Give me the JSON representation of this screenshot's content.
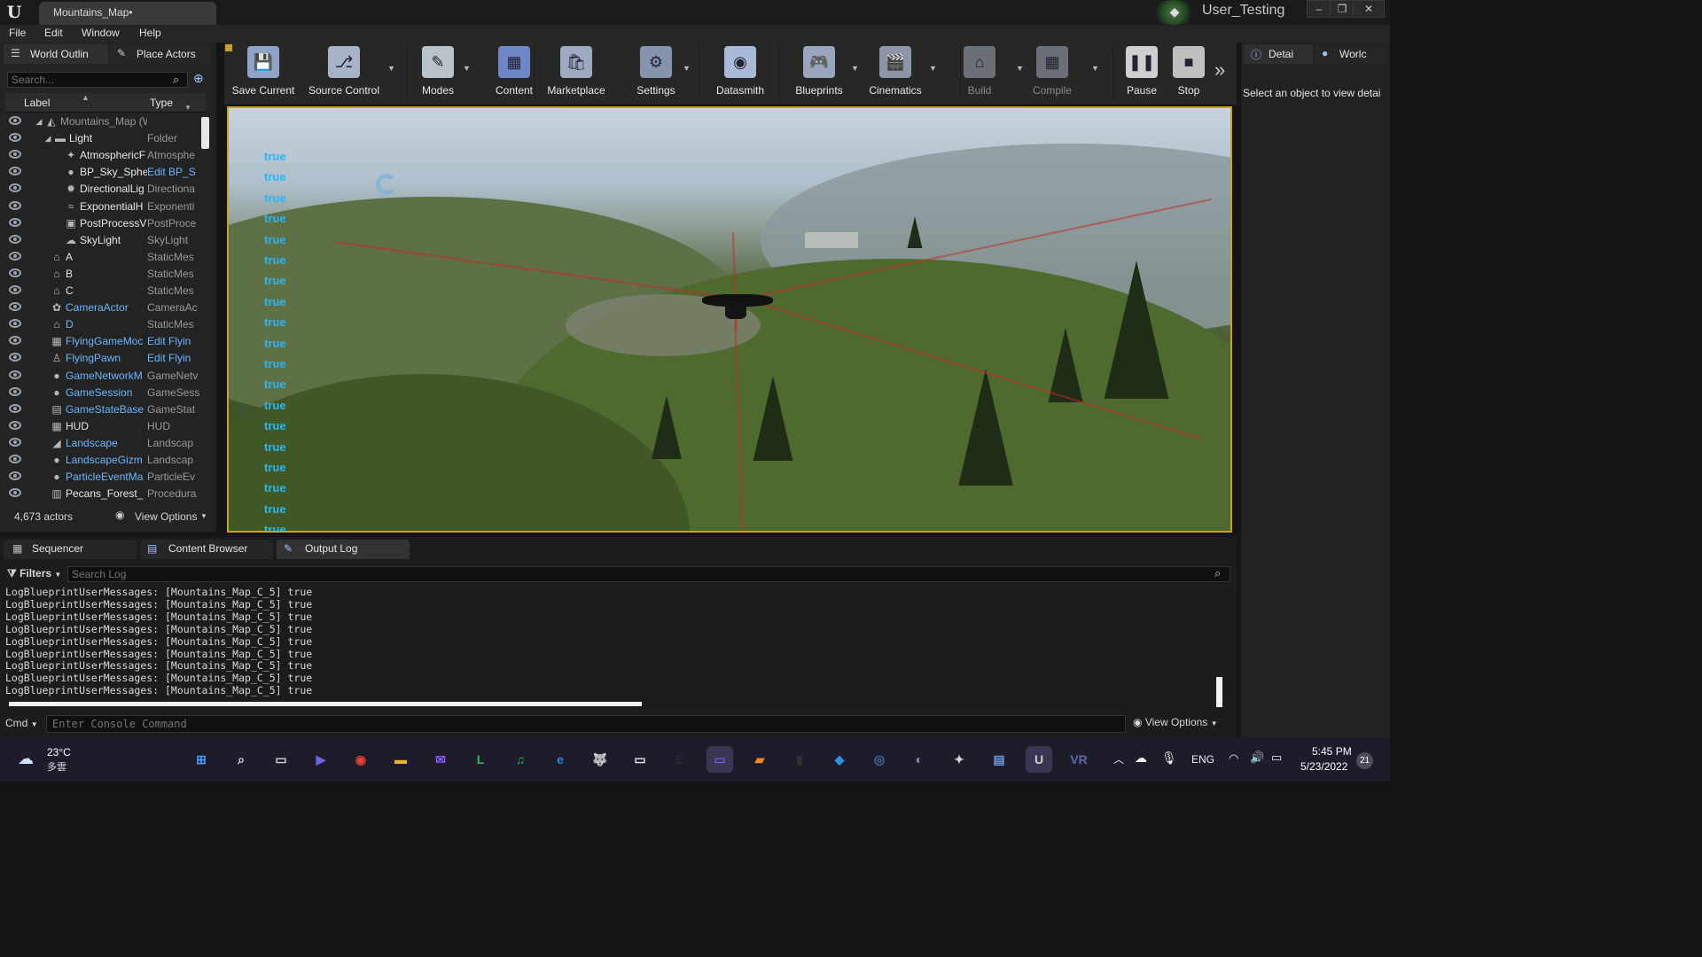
{
  "window": {
    "tab_title": "Mountains_Map•",
    "project": "User_Testing",
    "min": "–",
    "max": "❐",
    "close": "✕"
  },
  "menu": [
    "File",
    "Edit",
    "Window",
    "Help"
  ],
  "outliner": {
    "tab_world": "World Outlin",
    "tab_place": "Place Actors",
    "search_placeholder": "Search...",
    "col_label": "Label",
    "col_type": "Type",
    "rows": [
      {
        "label": "Mountains_Map (World",
        "type": "",
        "icon": "world-icon"
      },
      {
        "label": "Light",
        "type": "Folder",
        "icon": "folder-icon"
      },
      {
        "label": "AtmosphericF",
        "type": "Atmosphe",
        "icon": "atmosphere-icon"
      },
      {
        "label": "BP_Sky_Sphe",
        "type": "Edit BP_S",
        "icon": "sphere-icon"
      },
      {
        "label": "DirectionalLig",
        "type": "Directiona",
        "icon": "sun-icon"
      },
      {
        "label": "ExponentialH",
        "type": "Exponenti",
        "icon": "fog-icon"
      },
      {
        "label": "PostProcessV",
        "type": "PostProce",
        "icon": "postprocess-icon"
      },
      {
        "label": "SkyLight",
        "type": "SkyLight",
        "icon": "skylight-icon"
      },
      {
        "label": "A",
        "type": "StaticMes",
        "icon": "mesh-icon"
      },
      {
        "label": "B",
        "type": "StaticMes",
        "icon": "mesh-icon"
      },
      {
        "label": "C",
        "type": "StaticMes",
        "icon": "mesh-icon"
      },
      {
        "label": "CameraActor",
        "type": "CameraAc",
        "icon": "camera-icon"
      },
      {
        "label": "D",
        "type": "StaticMes",
        "icon": "mesh-icon"
      },
      {
        "label": "FlyingGameMoc",
        "type": "Edit Flyin",
        "icon": "gamemode-icon"
      },
      {
        "label": "FlyingPawn",
        "type": "Edit Flyin",
        "icon": "pawn-icon"
      },
      {
        "label": "GameNetworkM",
        "type": "GameNetv",
        "icon": "sphere-icon"
      },
      {
        "label": "GameSession",
        "type": "GameSess",
        "icon": "sphere-icon"
      },
      {
        "label": "GameStateBase",
        "type": "GameStat",
        "icon": "gamestate-icon"
      },
      {
        "label": "HUD",
        "type": "HUD",
        "icon": "hud-icon"
      },
      {
        "label": "Landscape",
        "type": "Landscap",
        "icon": "landscape-icon"
      },
      {
        "label": "LandscapeGizm",
        "type": "Landscap",
        "icon": "sphere-icon"
      },
      {
        "label": "ParticleEventMa",
        "type": "ParticleEv",
        "icon": "sphere-icon"
      },
      {
        "label": "Pecans_Forest_",
        "type": "Procedura",
        "icon": "procedural-icon"
      }
    ],
    "actor_count": "4,673 actors",
    "view_options": "View Options"
  },
  "toolbar": [
    {
      "label": "Save Current",
      "color": "#8fa3c8"
    },
    {
      "label": "Source Control",
      "color": "#a7b3c8"
    },
    {
      "label": "Modes",
      "color": "#b9c2c9"
    },
    {
      "label": "Content",
      "color": "#6f86c7"
    },
    {
      "label": "Marketplace",
      "color": "#9ca9c0"
    },
    {
      "label": "Settings",
      "color": "#8794ad"
    },
    {
      "label": "Datasmith",
      "color": "#a9b9d8"
    },
    {
      "label": "Blueprints",
      "color": "#9aa6bf"
    },
    {
      "label": "Cinematics",
      "color": "#8d96a7"
    },
    {
      "label": "Build",
      "color": "#6b6f76"
    },
    {
      "label": "Compile",
      "color": "#6b6f76"
    },
    {
      "label": "Pause",
      "color": "#cfcfcf"
    },
    {
      "label": "Stop",
      "color": "#bfbfbf"
    }
  ],
  "viewport": {
    "messages": [
      "true",
      "true",
      "true",
      "true",
      "true",
      "true",
      "true",
      "true",
      "true",
      "true",
      "true",
      "true",
      "true",
      "true",
      "true",
      "true",
      "true",
      "true",
      "true"
    ]
  },
  "details": {
    "tab_details": "Detai",
    "tab_world": "Worlc",
    "empty_text": "Select an object to view detai"
  },
  "bottom": {
    "tabs": [
      "Sequencer",
      "Content Browser",
      "Output Log"
    ],
    "filters": "Filters",
    "search_placeholder": "Search Log",
    "log_lines": [
      "LogBlueprintUserMessages: [Mountains_Map_C_5] true",
      "LogBlueprintUserMessages: [Mountains_Map_C_5] true",
      "LogBlueprintUserMessages: [Mountains_Map_C_5] true",
      "LogBlueprintUserMessages: [Mountains_Map_C_5] true",
      "LogBlueprintUserMessages: [Mountains_Map_C_5] true",
      "LogBlueprintUserMessages: [Mountains_Map_C_5] true",
      "LogBlueprintUserMessages: [Mountains_Map_C_5] true",
      "LogBlueprintUserMessages: [Mountains_Map_C_5] true",
      "LogBlueprintUserMessages: [Mountains_Map_C_5] true"
    ],
    "cmd": "Cmd",
    "console_placeholder": "Enter Console Command",
    "view_options": "View Options"
  },
  "taskbar": {
    "weather_temp": "23°C",
    "weather_desc": "多雲",
    "apps": [
      {
        "name": "start",
        "color": "#3aa0ff"
      },
      {
        "name": "search",
        "color": "#e0e0e0"
      },
      {
        "name": "task-view",
        "color": "#d0d0d0"
      },
      {
        "name": "chat",
        "color": "#6b67e0"
      },
      {
        "name": "chrome",
        "color": "#e34133"
      },
      {
        "name": "files",
        "color": "#e8b428"
      },
      {
        "name": "messenger",
        "color": "#8a5cf5"
      },
      {
        "name": "line",
        "color": "#25c14a"
      },
      {
        "name": "spotify",
        "color": "#1db954"
      },
      {
        "name": "edge",
        "color": "#1f8fd6"
      },
      {
        "name": "app-wolf",
        "color": "#dcdcdc"
      },
      {
        "name": "oculus",
        "color": "#e8e8e8"
      },
      {
        "name": "epic-games",
        "color": "#2a2a2a"
      },
      {
        "name": "streaming-app",
        "color": "#6a5ce0"
      },
      {
        "name": "sublime",
        "color": "#f08a1c"
      },
      {
        "name": "terminal",
        "color": "#303030"
      },
      {
        "name": "vscode",
        "color": "#2f8fe0"
      },
      {
        "name": "steam",
        "color": "#4a6fa0"
      },
      {
        "name": "github",
        "color": "#8a8ac8"
      },
      {
        "name": "game-app",
        "color": "#d8d8d8"
      },
      {
        "name": "notepad",
        "color": "#6a9ae0"
      },
      {
        "name": "unreal",
        "color": "#cfcfcf"
      },
      {
        "name": "vr-app",
        "color": "#5a6aa8"
      }
    ],
    "lang": "ENG",
    "time": "5:45 PM",
    "date": "5/23/2022",
    "notif": "21"
  }
}
